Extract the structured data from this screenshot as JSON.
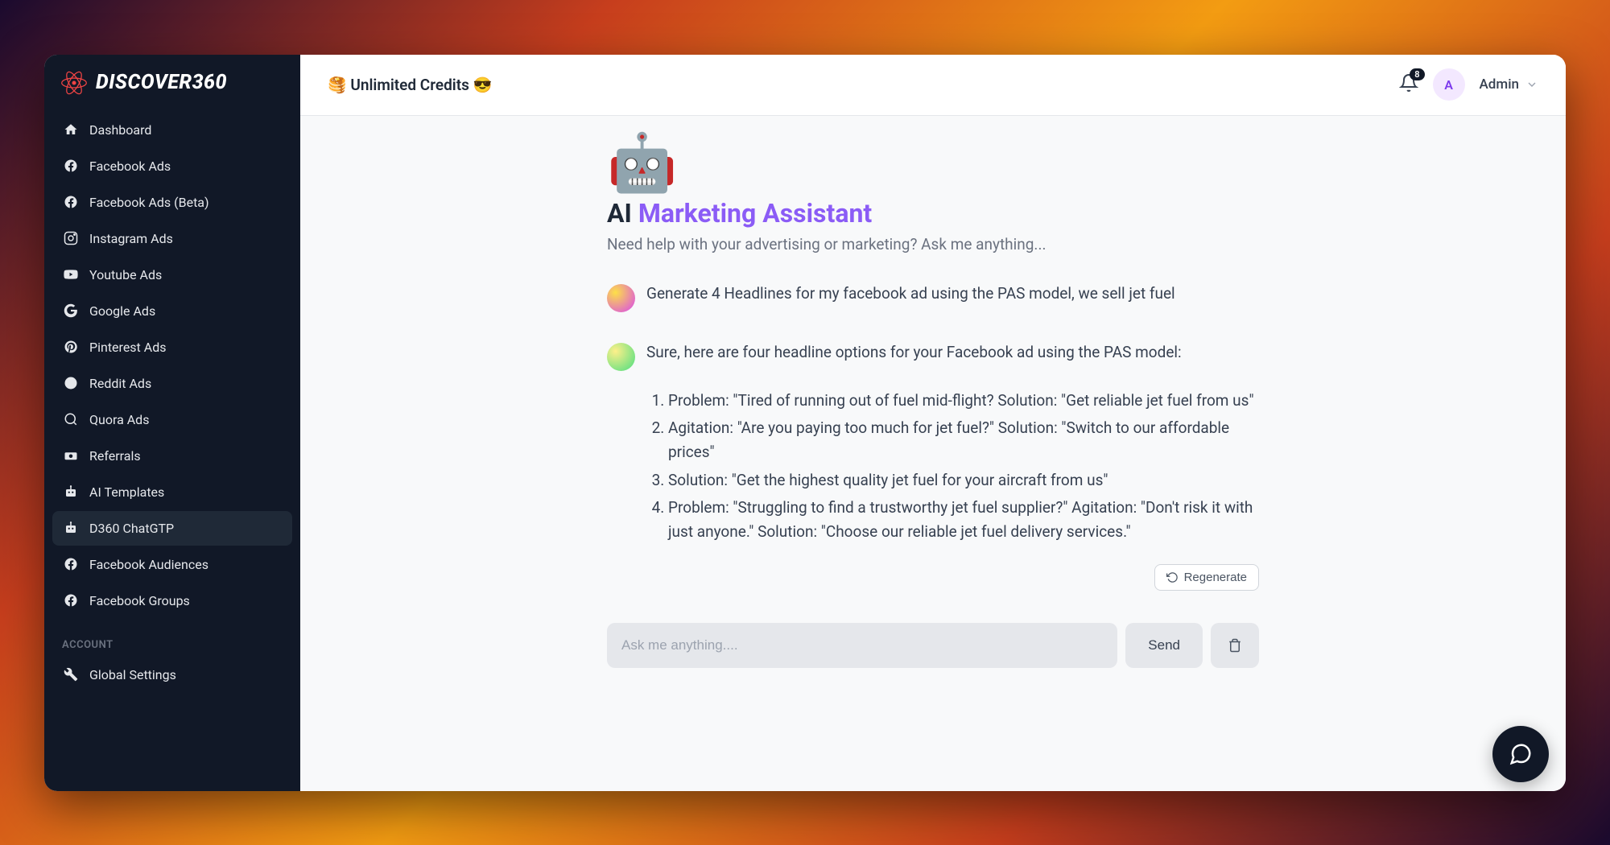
{
  "brand": "DISCOVER360",
  "sidebar": {
    "items": [
      {
        "label": "Dashboard",
        "icon": "home"
      },
      {
        "label": "Facebook Ads",
        "icon": "facebook"
      },
      {
        "label": "Facebook Ads (Beta)",
        "icon": "facebook"
      },
      {
        "label": "Instagram Ads",
        "icon": "instagram"
      },
      {
        "label": "Youtube Ads",
        "icon": "youtube"
      },
      {
        "label": "Google Ads",
        "icon": "google"
      },
      {
        "label": "Pinterest Ads",
        "icon": "pinterest"
      },
      {
        "label": "Reddit Ads",
        "icon": "reddit"
      },
      {
        "label": "Quora Ads",
        "icon": "quora"
      },
      {
        "label": "Referrals",
        "icon": "referrals"
      },
      {
        "label": "AI Templates",
        "icon": "robot"
      },
      {
        "label": "D360 ChatGTP",
        "icon": "robot",
        "active": true
      },
      {
        "label": "Facebook Audiences",
        "icon": "facebook"
      },
      {
        "label": "Facebook Groups",
        "icon": "facebook"
      }
    ],
    "account_label": "ACCOUNT",
    "settings_label": "Global Settings"
  },
  "topbar": {
    "credits": "🥞 Unlimited Credits 😎",
    "notifications_count": "8",
    "avatar_initial": "A",
    "user_name": "Admin"
  },
  "chat": {
    "robot_emoji": "🤖",
    "title_ai": "AI",
    "title_marketing": "Marketing Assistant",
    "subtitle": "Need help with your advertising or marketing? Ask me anything...",
    "user_message": "Generate 4 Headlines for my facebook ad using the PAS model, we sell jet fuel",
    "assistant_intro": "Sure, here are four headline options for your Facebook ad using the PAS model:",
    "response_items": [
      "Problem: \"Tired of running out of fuel mid-flight? Solution: \"Get reliable jet fuel from us\"",
      "Agitation: \"Are you paying too much for jet fuel?\" Solution: \"Switch to our affordable prices\"",
      "Solution: \"Get the highest quality jet fuel for your aircraft from us\"",
      "Problem: \"Struggling to find a trustworthy jet fuel supplier?\" Agitation: \"Don't risk it with just anyone.\" Solution: \"Choose our reliable jet fuel delivery services.\""
    ],
    "regenerate_label": "Regenerate",
    "input_placeholder": "Ask me anything....",
    "send_label": "Send"
  }
}
